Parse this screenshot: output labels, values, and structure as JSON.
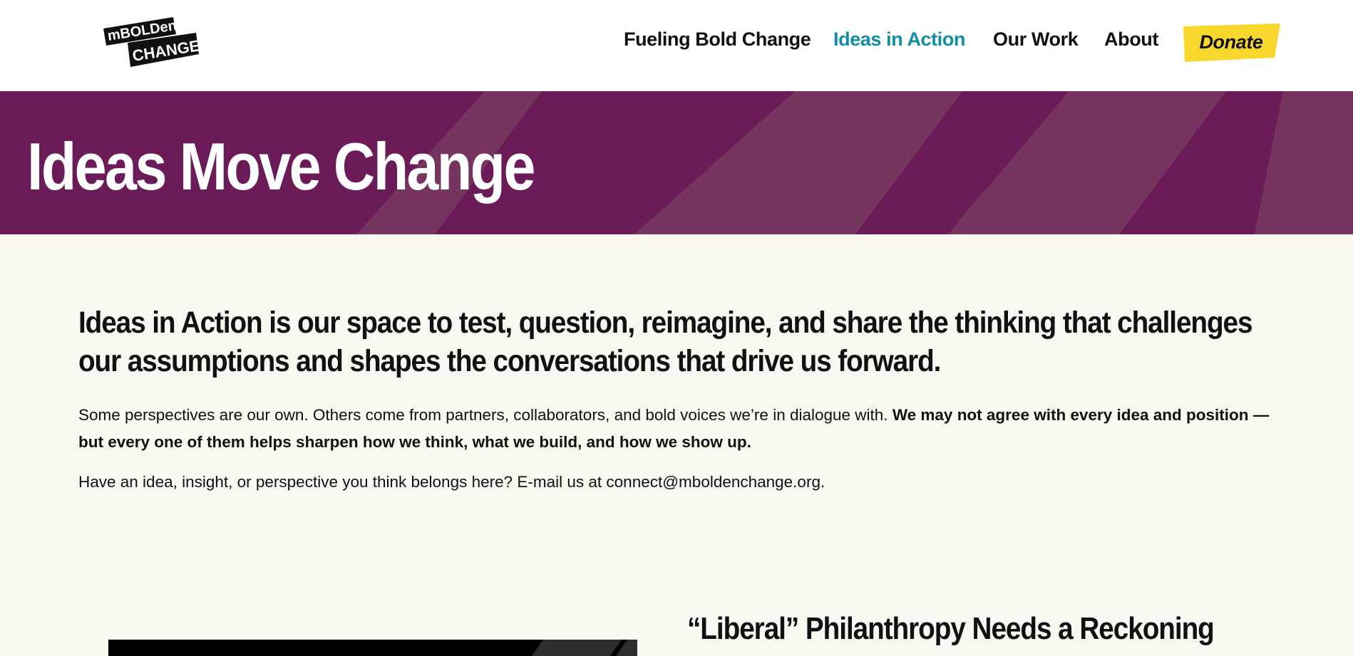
{
  "header": {
    "logo": {
      "line1": "mBOLDen",
      "line2": "CHANGE"
    },
    "nav": {
      "items": [
        {
          "label": "Fueling Bold Change",
          "active": false
        },
        {
          "label": "Ideas in Action",
          "active": true
        },
        {
          "label": "Our Work",
          "active": false
        },
        {
          "label": "About",
          "active": false
        }
      ],
      "donate_label": "Donate"
    }
  },
  "hero": {
    "title": "Ideas Move Change"
  },
  "intro": {
    "heading": "Ideas in Action is our space to test, question, reimagine, and share the thinking that challenges our assumptions and shapes the conversations that drive us forward.",
    "paragraph1_regular": "Some perspectives are our own. Others come from partners, collaborators, and bold voices we’re in dialogue with. ",
    "paragraph1_bold": "We may not agree with every idea and position — but every one of them helps sharpen how we think, what we build, and how we show up.",
    "paragraph2": "Have an idea, insight, or perspective you think belongs here? E-mail us at connect@mboldenchange.org."
  },
  "article": {
    "title": "“Liberal” Philanthropy Needs a Reckoning"
  },
  "colors": {
    "hero_bg": "#6b1b57",
    "hero_stripe": "#76355f",
    "active_nav": "#0f8fa6",
    "donate_bg": "#f8d72c",
    "page_bg": "#faf7f0"
  }
}
